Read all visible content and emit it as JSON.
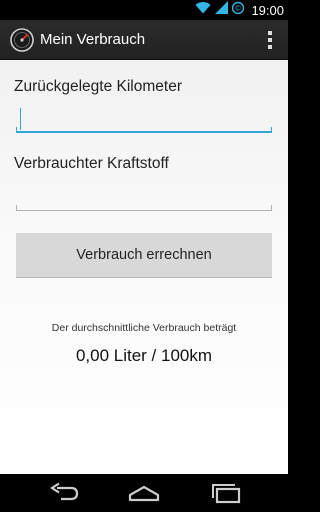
{
  "status_bar": {
    "time": "19:00",
    "icons": [
      "wifi-icon",
      "signal-icon",
      "battery-icon"
    ],
    "colors": {
      "icons": "#33b5e5"
    }
  },
  "action_bar": {
    "title": "Mein Verbrauch",
    "app_icon": "speedometer-icon",
    "overflow_icon": "overflow-menu-icon"
  },
  "form": {
    "km_label": "Zurückgelegte Kilometer",
    "km_value": "",
    "fuel_label": "Verbrauchter Kraftstoff",
    "fuel_value": "",
    "calculate_button": "Verbrauch errechnen",
    "accent_color": "#33a7d3"
  },
  "result": {
    "caption": "Der durchschnittliche Verbrauch beträgt",
    "value": "0,00 Liter / 100km"
  },
  "nav_bar": {
    "back_icon": "back-icon",
    "home_icon": "home-icon",
    "recents_icon": "recent-apps-icon"
  }
}
